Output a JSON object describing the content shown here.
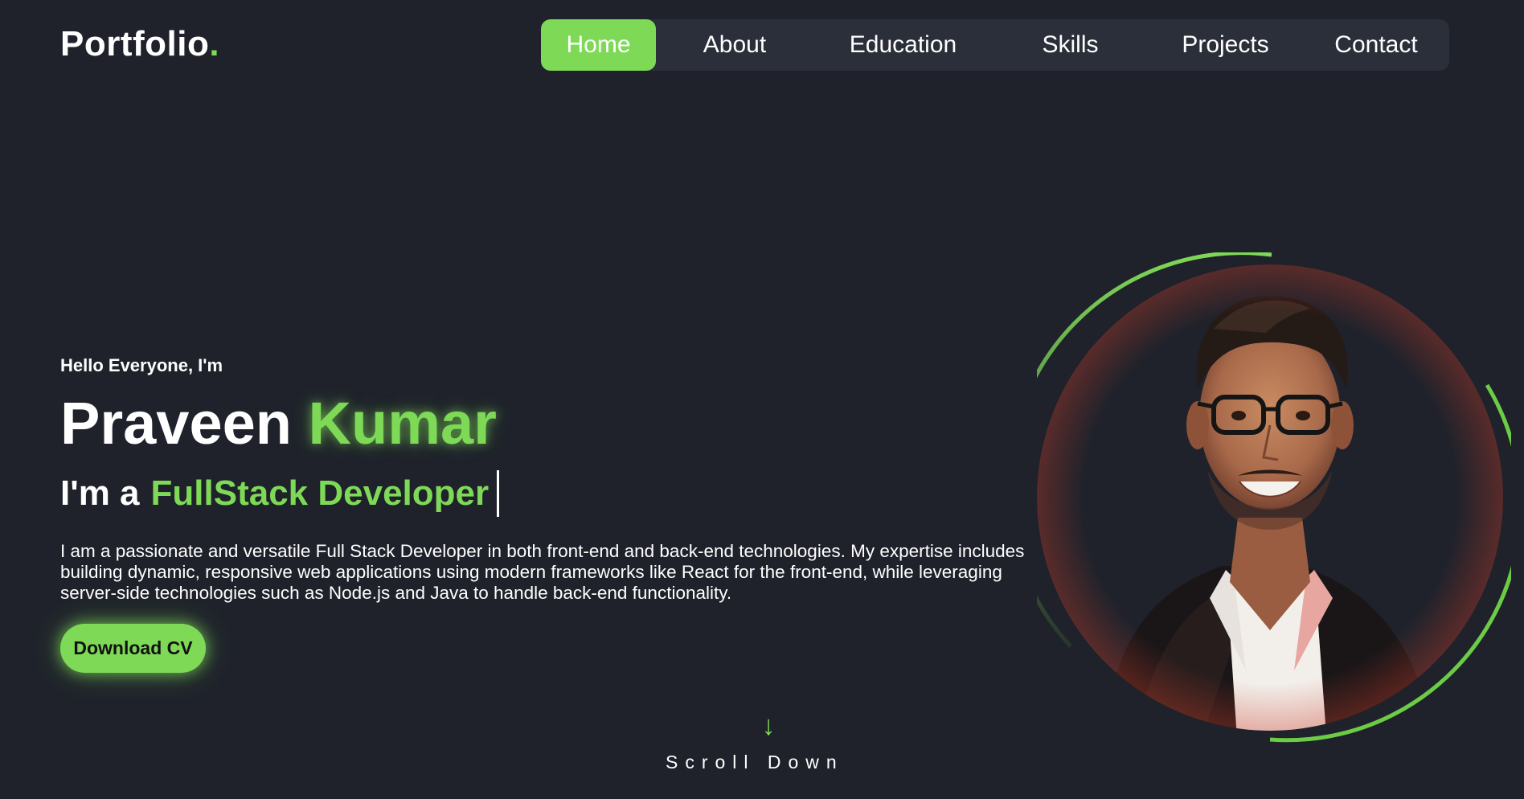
{
  "header": {
    "logo_text": "Portfolio",
    "logo_dot": ".",
    "nav": [
      {
        "label": "Home",
        "active": true
      },
      {
        "label": "About",
        "active": false
      },
      {
        "label": "Education",
        "active": false
      },
      {
        "label": "Skills",
        "active": false
      },
      {
        "label": "Projects",
        "active": false
      },
      {
        "label": "Contact",
        "active": false
      }
    ]
  },
  "hero": {
    "greeting": "Hello Everyone, I'm",
    "first_name": "Praveen",
    "last_name": "Kumar",
    "role_prefix": "I'm a",
    "role_highlight": "FullStack Developer",
    "bio": "I am a passionate and versatile Full Stack Developer in both front-end and back-end technologies. My expertise includes building dynamic, responsive web applications using modern frameworks like React for the front-end, while leveraging server-side technologies such as Node.js and Java to handle back-end functionality.",
    "cta_label": "Download CV"
  },
  "scroll": {
    "arrow": "↓",
    "label": "Scroll Down"
  },
  "icons": {
    "scroll_arrow": "arrow-down-icon"
  },
  "colors": {
    "background": "#1f222b",
    "nav_background": "#2b2f3a",
    "accent": "#7ed957",
    "text": "#ffffff"
  }
}
